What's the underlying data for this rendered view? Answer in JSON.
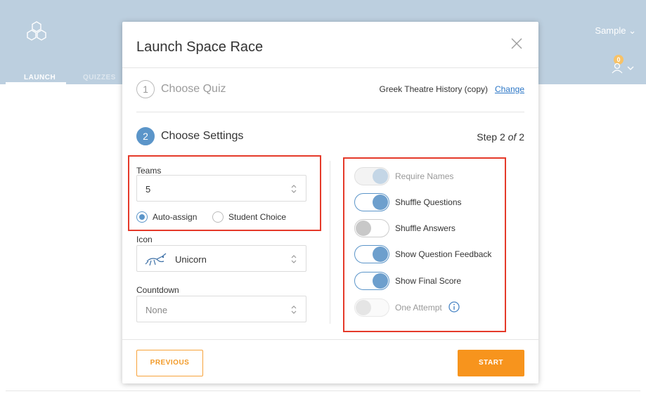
{
  "app": {
    "user_menu": "Sample ⌄",
    "notification_count": "0",
    "nav": [
      "LAUNCH",
      "QUIZZES"
    ]
  },
  "modal": {
    "title": "Launch Space Race",
    "step1": {
      "number": "1",
      "label": "Choose Quiz",
      "quiz_name": "Greek Theatre History (copy)",
      "change_label": "Change"
    },
    "step2": {
      "number": "2",
      "label": "Choose Settings",
      "step_text": "Step 2",
      "of_text": "of",
      "total": "2"
    },
    "teams": {
      "label": "Teams",
      "value": "5",
      "options": [
        "Auto-assign",
        "Student Choice"
      ],
      "selected": "Auto-assign"
    },
    "icon": {
      "label": "Icon",
      "value": "Unicorn"
    },
    "countdown": {
      "label": "Countdown",
      "value": "None"
    },
    "toggles": [
      {
        "label": "Require Names",
        "state": "on",
        "disabled": true
      },
      {
        "label": "Shuffle Questions",
        "state": "on",
        "disabled": false
      },
      {
        "label": "Shuffle Answers",
        "state": "off",
        "disabled": false
      },
      {
        "label": "Show Question Feedback",
        "state": "on",
        "disabled": false
      },
      {
        "label": "Show Final Score",
        "state": "on",
        "disabled": false
      },
      {
        "label": "One Attempt",
        "state": "off",
        "disabled": true
      }
    ],
    "buttons": {
      "previous": "PREVIOUS",
      "start": "START"
    }
  },
  "colors": {
    "accent": "#5b95c9",
    "orange": "#f7941d",
    "highlight": "#e53a2a",
    "header_bg": "#bccfdf"
  }
}
